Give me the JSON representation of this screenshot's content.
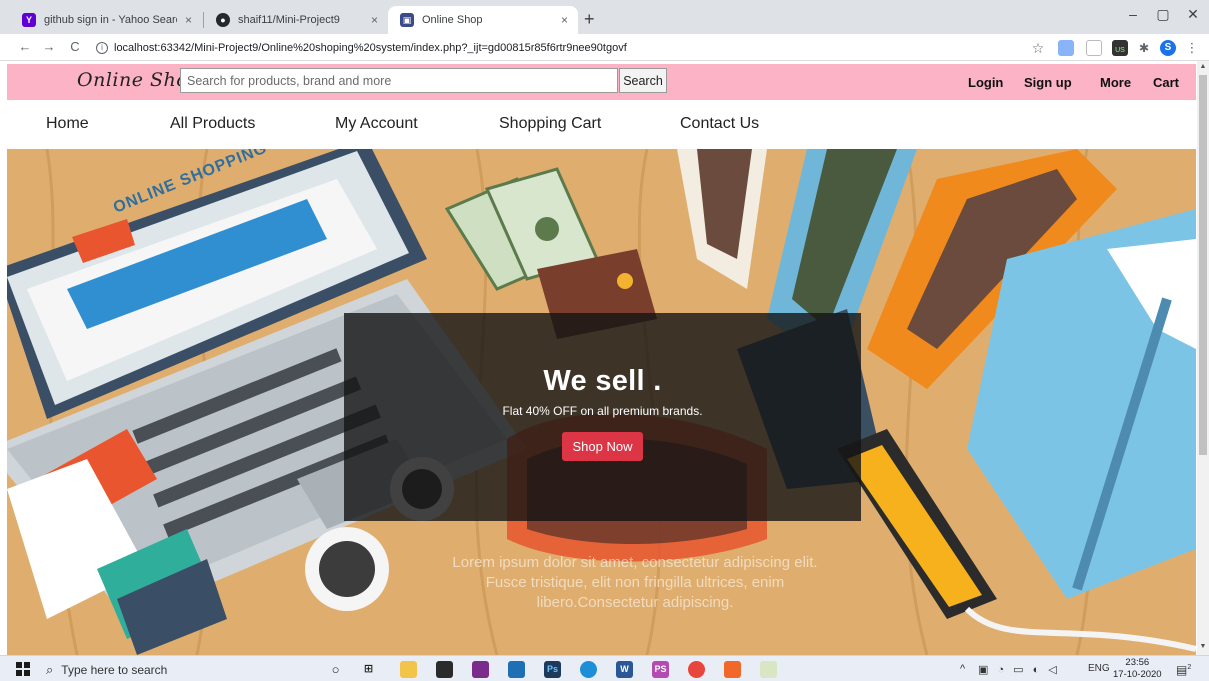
{
  "browser": {
    "tabs": [
      {
        "title": "github sign in - Yahoo Search Re",
        "close": "×"
      },
      {
        "title": "shaif11/Mini-Project9",
        "close": "×"
      },
      {
        "title": "Online Shop",
        "close": "×"
      }
    ],
    "new_tab": "+",
    "window_controls": {
      "minimize": "–",
      "maximize": "▢",
      "close": "✕"
    },
    "nav": {
      "back": "←",
      "forward": "→",
      "reload": "C"
    },
    "url": "localhost:63342/Mini-Project9/Online%20shoping%20system/index.php?_ijt=gd00815r85f6rtr9nee90tgovf",
    "extensions": {
      "star": "☆",
      "profile": "S",
      "puzzle": "✱",
      "menu": "⋮",
      "badge": "US"
    }
  },
  "header": {
    "logo": "Online Shop",
    "search_placeholder": "Search for products, brand and more",
    "search_button": "Search",
    "links": {
      "login": "Login",
      "signup": "Sign up",
      "more": "More",
      "cart": "Cart"
    },
    "bg_color": "#fbb3c5"
  },
  "nav": {
    "home": "Home",
    "all_products": "All Products",
    "my_account": "My Account",
    "shopping_cart": "Shopping Cart",
    "contact_us": "Contact Us"
  },
  "hero": {
    "title": "We sell .",
    "subtitle": "Flat 40% OFF on all premium brands.",
    "cta": "Shop Now",
    "cta_color": "#dc3545",
    "image_text": {
      "laptop_banner": "ONLINE SHOPPING",
      "lorem": "Lorem ipsum dolor sit amet, consectetur adipiscing elit. Fusce tristique, elit non fringilla ultrices, enim libero.Consectetur adipiscing."
    }
  },
  "taskbar": {
    "search_placeholder": "Type here to search",
    "language": "ENG",
    "time": "23:56",
    "date": "17-10-2020",
    "notifications": "2"
  }
}
